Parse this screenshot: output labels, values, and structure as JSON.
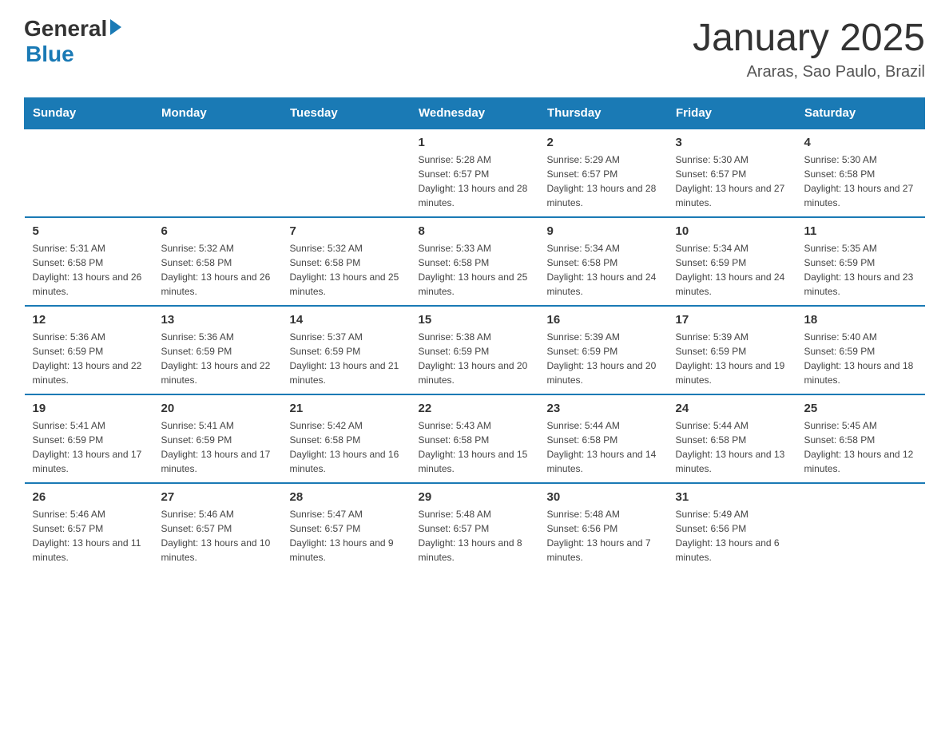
{
  "logo": {
    "general": "General",
    "blue": "Blue"
  },
  "calendar": {
    "title": "January 2025",
    "subtitle": "Araras, Sao Paulo, Brazil",
    "days_of_week": [
      "Sunday",
      "Monday",
      "Tuesday",
      "Wednesday",
      "Thursday",
      "Friday",
      "Saturday"
    ],
    "weeks": [
      [
        {
          "day": "",
          "info": ""
        },
        {
          "day": "",
          "info": ""
        },
        {
          "day": "",
          "info": ""
        },
        {
          "day": "1",
          "info": "Sunrise: 5:28 AM\nSunset: 6:57 PM\nDaylight: 13 hours and 28 minutes."
        },
        {
          "day": "2",
          "info": "Sunrise: 5:29 AM\nSunset: 6:57 PM\nDaylight: 13 hours and 28 minutes."
        },
        {
          "day": "3",
          "info": "Sunrise: 5:30 AM\nSunset: 6:57 PM\nDaylight: 13 hours and 27 minutes."
        },
        {
          "day": "4",
          "info": "Sunrise: 5:30 AM\nSunset: 6:58 PM\nDaylight: 13 hours and 27 minutes."
        }
      ],
      [
        {
          "day": "5",
          "info": "Sunrise: 5:31 AM\nSunset: 6:58 PM\nDaylight: 13 hours and 26 minutes."
        },
        {
          "day": "6",
          "info": "Sunrise: 5:32 AM\nSunset: 6:58 PM\nDaylight: 13 hours and 26 minutes."
        },
        {
          "day": "7",
          "info": "Sunrise: 5:32 AM\nSunset: 6:58 PM\nDaylight: 13 hours and 25 minutes."
        },
        {
          "day": "8",
          "info": "Sunrise: 5:33 AM\nSunset: 6:58 PM\nDaylight: 13 hours and 25 minutes."
        },
        {
          "day": "9",
          "info": "Sunrise: 5:34 AM\nSunset: 6:58 PM\nDaylight: 13 hours and 24 minutes."
        },
        {
          "day": "10",
          "info": "Sunrise: 5:34 AM\nSunset: 6:59 PM\nDaylight: 13 hours and 24 minutes."
        },
        {
          "day": "11",
          "info": "Sunrise: 5:35 AM\nSunset: 6:59 PM\nDaylight: 13 hours and 23 minutes."
        }
      ],
      [
        {
          "day": "12",
          "info": "Sunrise: 5:36 AM\nSunset: 6:59 PM\nDaylight: 13 hours and 22 minutes."
        },
        {
          "day": "13",
          "info": "Sunrise: 5:36 AM\nSunset: 6:59 PM\nDaylight: 13 hours and 22 minutes."
        },
        {
          "day": "14",
          "info": "Sunrise: 5:37 AM\nSunset: 6:59 PM\nDaylight: 13 hours and 21 minutes."
        },
        {
          "day": "15",
          "info": "Sunrise: 5:38 AM\nSunset: 6:59 PM\nDaylight: 13 hours and 20 minutes."
        },
        {
          "day": "16",
          "info": "Sunrise: 5:39 AM\nSunset: 6:59 PM\nDaylight: 13 hours and 20 minutes."
        },
        {
          "day": "17",
          "info": "Sunrise: 5:39 AM\nSunset: 6:59 PM\nDaylight: 13 hours and 19 minutes."
        },
        {
          "day": "18",
          "info": "Sunrise: 5:40 AM\nSunset: 6:59 PM\nDaylight: 13 hours and 18 minutes."
        }
      ],
      [
        {
          "day": "19",
          "info": "Sunrise: 5:41 AM\nSunset: 6:59 PM\nDaylight: 13 hours and 17 minutes."
        },
        {
          "day": "20",
          "info": "Sunrise: 5:41 AM\nSunset: 6:59 PM\nDaylight: 13 hours and 17 minutes."
        },
        {
          "day": "21",
          "info": "Sunrise: 5:42 AM\nSunset: 6:58 PM\nDaylight: 13 hours and 16 minutes."
        },
        {
          "day": "22",
          "info": "Sunrise: 5:43 AM\nSunset: 6:58 PM\nDaylight: 13 hours and 15 minutes."
        },
        {
          "day": "23",
          "info": "Sunrise: 5:44 AM\nSunset: 6:58 PM\nDaylight: 13 hours and 14 minutes."
        },
        {
          "day": "24",
          "info": "Sunrise: 5:44 AM\nSunset: 6:58 PM\nDaylight: 13 hours and 13 minutes."
        },
        {
          "day": "25",
          "info": "Sunrise: 5:45 AM\nSunset: 6:58 PM\nDaylight: 13 hours and 12 minutes."
        }
      ],
      [
        {
          "day": "26",
          "info": "Sunrise: 5:46 AM\nSunset: 6:57 PM\nDaylight: 13 hours and 11 minutes."
        },
        {
          "day": "27",
          "info": "Sunrise: 5:46 AM\nSunset: 6:57 PM\nDaylight: 13 hours and 10 minutes."
        },
        {
          "day": "28",
          "info": "Sunrise: 5:47 AM\nSunset: 6:57 PM\nDaylight: 13 hours and 9 minutes."
        },
        {
          "day": "29",
          "info": "Sunrise: 5:48 AM\nSunset: 6:57 PM\nDaylight: 13 hours and 8 minutes."
        },
        {
          "day": "30",
          "info": "Sunrise: 5:48 AM\nSunset: 6:56 PM\nDaylight: 13 hours and 7 minutes."
        },
        {
          "day": "31",
          "info": "Sunrise: 5:49 AM\nSunset: 6:56 PM\nDaylight: 13 hours and 6 minutes."
        },
        {
          "day": "",
          "info": ""
        }
      ]
    ]
  }
}
